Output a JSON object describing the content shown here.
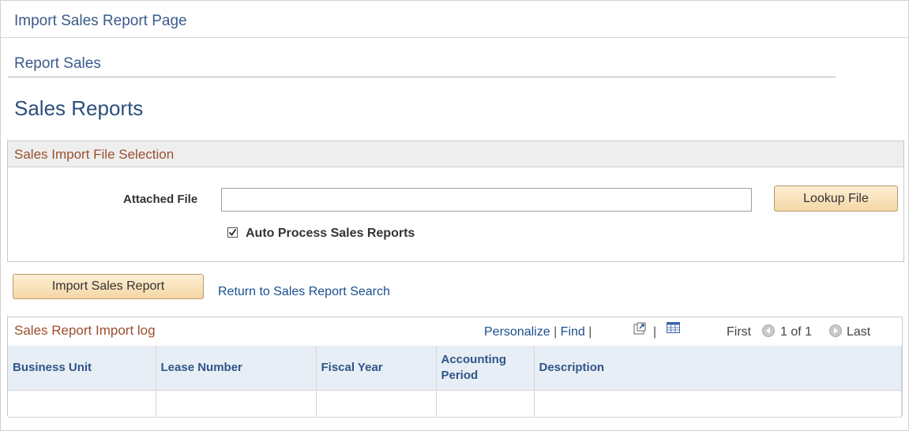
{
  "top_title": "Import Sales Report Page",
  "tab_title": "Report Sales",
  "page_title": "Sales Reports",
  "file_section": {
    "title": "Sales Import File Selection",
    "attached_file_label": "Attached File",
    "attached_file_value": "",
    "lookup_button": "Lookup File",
    "auto_process_label": "Auto Process Sales Reports",
    "auto_process_checked": true
  },
  "actions": {
    "import_button": "Import Sales Report",
    "return_link": "Return to Sales Report Search"
  },
  "log_grid": {
    "title": "Sales Report Import log",
    "personalize": "Personalize",
    "find": "Find",
    "first": "First",
    "page_count": "1 of 1",
    "last": "Last",
    "columns": [
      "Business Unit",
      "Lease Number",
      "Fiscal Year",
      "Accounting Period",
      "Description"
    ],
    "rows": [
      [
        "",
        "",
        "",
        "",
        ""
      ]
    ]
  },
  "colors": {
    "link": "#1a4f8e",
    "section_title": "#9a4f2e",
    "header_text": "#2f5687",
    "button_bg": "#f5d7a6"
  }
}
